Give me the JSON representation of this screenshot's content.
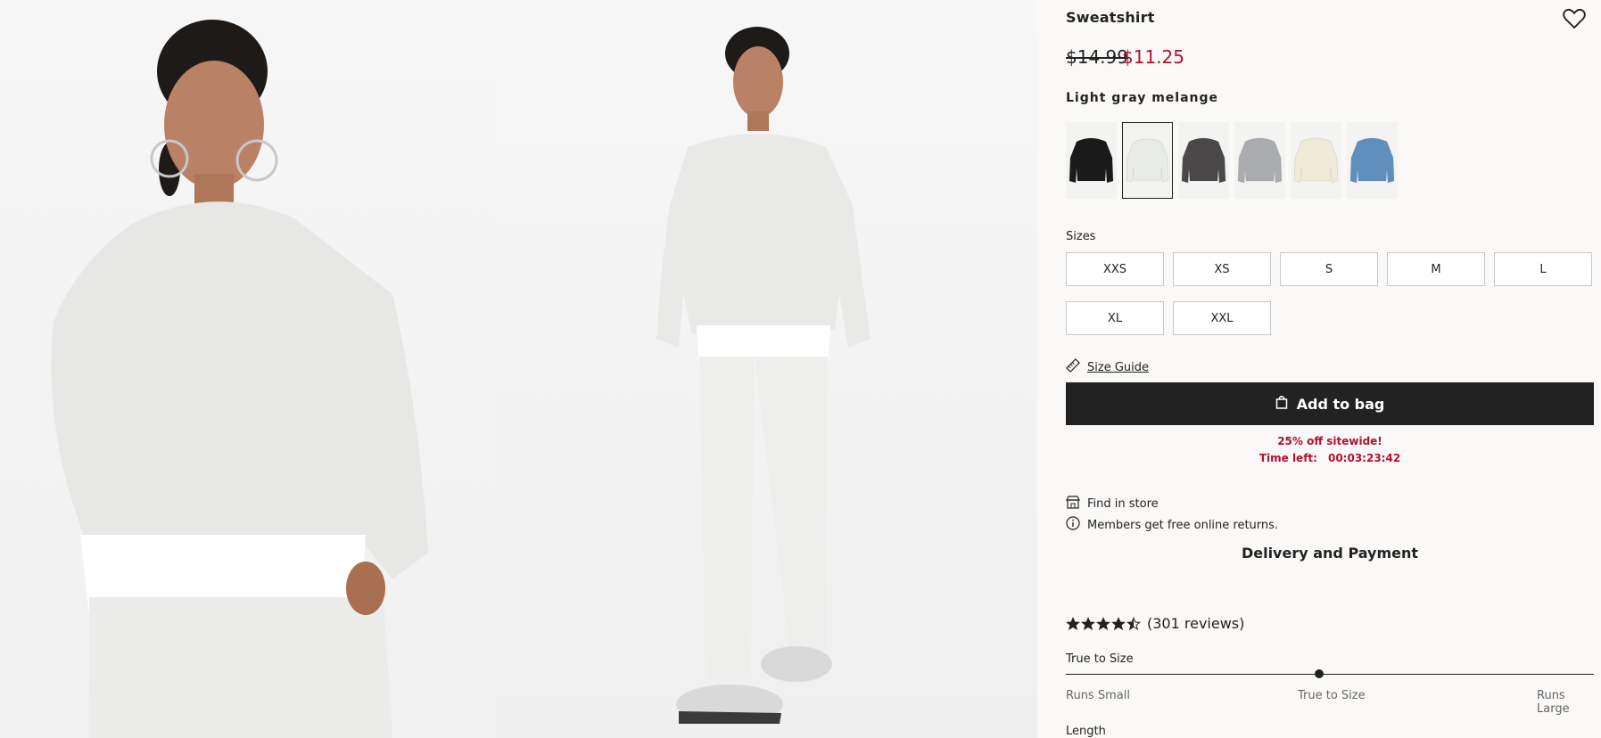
{
  "product": {
    "title": "Sweatshirt",
    "price_original": "$14.99",
    "price_sale": "$11.25",
    "color_name": "Light gray melange",
    "swatch_colors": [
      "#1a1a1a",
      "#e9ebe8",
      "#4a4848",
      "#a9abae",
      "#efe9d8",
      "#5f8fbd"
    ],
    "selected_swatch_index": 1
  },
  "sizes": {
    "label": "Sizes",
    "options": [
      "XXS",
      "XS",
      "S",
      "M",
      "L",
      "XL",
      "XXL"
    ]
  },
  "size_guide": "Size Guide",
  "add_to_bag": "Add to bag",
  "promo": {
    "headline": "25% off sitewide!",
    "time_label": "Time left:",
    "time_value": "00:03:23:42"
  },
  "info": {
    "find_in_store": "Find in store",
    "returns": "Members get free online returns.",
    "delivery": "Delivery and Payment"
  },
  "reviews": {
    "rating": 4.5,
    "count_text": "(301 reviews)"
  },
  "fit": {
    "label": "True to Size",
    "left": "Runs Small",
    "center": "True to Size",
    "right": "Runs Large",
    "position": 0.48
  },
  "length_label": "Length",
  "colors": {
    "sale": "#b5102e",
    "button": "#222222"
  }
}
